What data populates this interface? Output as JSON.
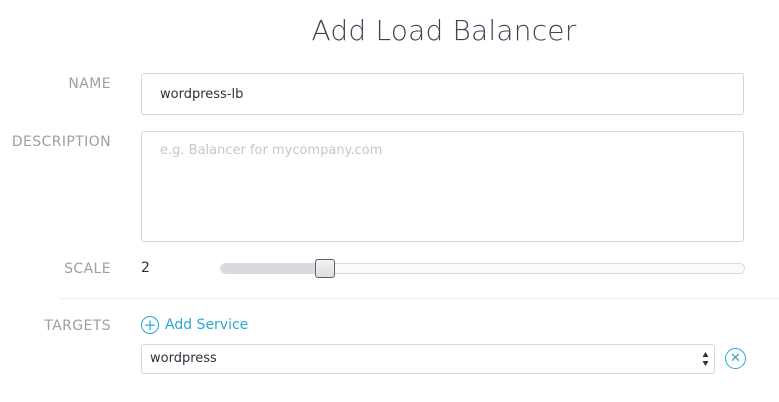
{
  "page": {
    "title": "Add Load Balancer"
  },
  "form": {
    "name": {
      "label": "NAME",
      "value": "wordpress-lb"
    },
    "description": {
      "label": "DESCRIPTION",
      "value": "",
      "placeholder": "e.g. Balancer for mycompany.com"
    },
    "scale": {
      "label": "SCALE",
      "value": "2",
      "slider_fraction": 0.2
    },
    "targets": {
      "label": "TARGETS",
      "add_label": "Add Service",
      "add_icon": "plus-circle-icon",
      "selected_service": "wordpress",
      "remove_icon": "close-circle-icon"
    }
  },
  "colors": {
    "accent": "#2aa7d8",
    "label": "#9aa0a8",
    "title": "#3d4555"
  }
}
